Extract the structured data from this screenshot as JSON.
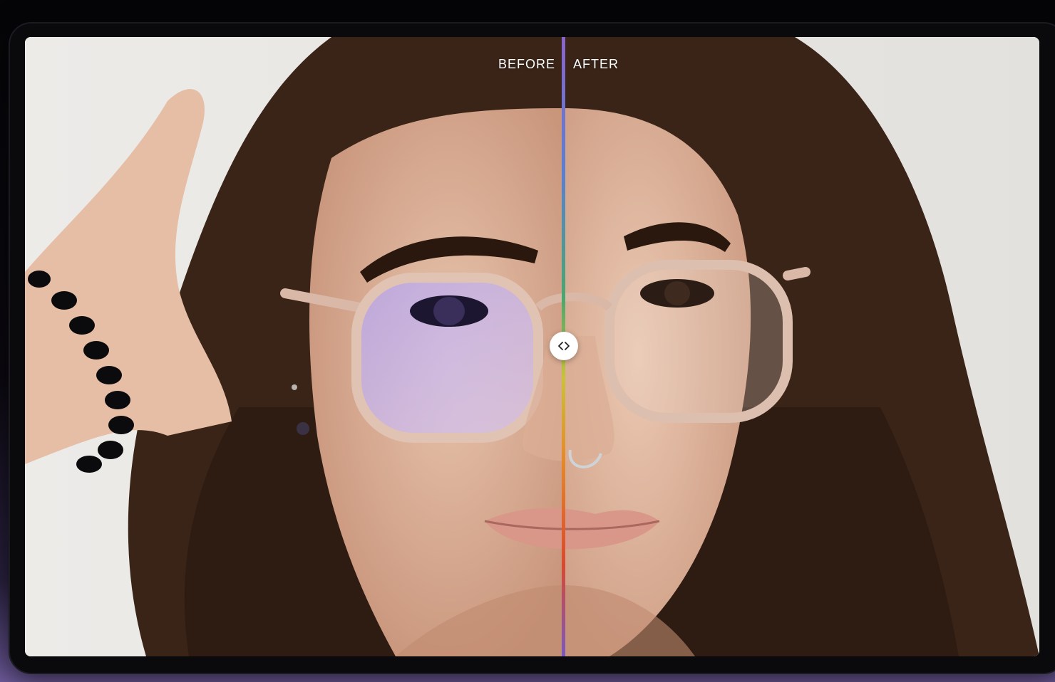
{
  "compare": {
    "before_label": "BEFORE",
    "after_label": "AFTER",
    "slider_icon": "chevrons-left-right-icon",
    "divider_position_percent": 53
  },
  "colors": {
    "background_top": "#050507",
    "background_bottom": "#6d5a9a",
    "divider_gradient": [
      "#8a66c9",
      "#5b7fd0",
      "#4aa66f",
      "#c9c23a",
      "#e58a2b",
      "#d94a2e",
      "#7a58c0"
    ]
  }
}
